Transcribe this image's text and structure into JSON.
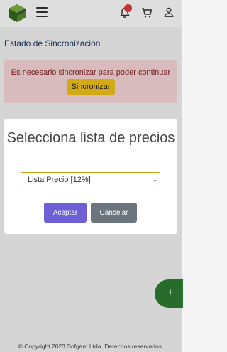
{
  "header": {
    "logo_icon": "cube-logo",
    "menu_icon": "hamburger-icon",
    "notification_icon": "bell-icon",
    "notification_count": "1",
    "cart_icon": "cart-icon",
    "user_icon": "user-icon"
  },
  "page": {
    "section_title": "Estado de Sincronización",
    "alert_text": "Es necesario sincronizar para poder continuar",
    "sync_button": "Sincronizar",
    "fab_label": "+"
  },
  "modal": {
    "title": "Selecciona lista de precios",
    "select_value": "Lista Precio [12%]",
    "accept_button": "Aceptar",
    "cancel_button": "Cancelar"
  },
  "footer": {
    "copyright": "© Copyright 2023 Sofgem Ltda. Derechos reservados."
  },
  "colors": {
    "alert_bg": "#f8d7da",
    "sync_button": "#f0c419",
    "accept_button": "#6f5fd6",
    "cancel_button": "#6b757d",
    "fab": "#2e7d32",
    "badge": "#e53935"
  }
}
